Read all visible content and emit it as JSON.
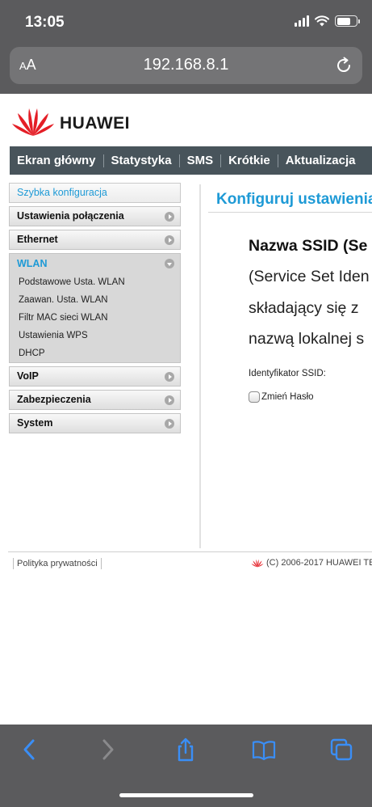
{
  "status_bar": {
    "time": "13:05"
  },
  "address_bar": {
    "aa_label_big": "A",
    "aa_label_small": "A",
    "url": "192.168.8.1"
  },
  "header": {
    "brand": "HUAWEI"
  },
  "nav": [
    "Ekran główny",
    "Statystyka",
    "SMS",
    "Krótkie",
    "Aktualizacja"
  ],
  "sidebar": {
    "quick": "Szybka konfiguracja",
    "menus_top": [
      "Ustawienia połączenia",
      "Ethernet"
    ],
    "wlan": {
      "label": "WLAN",
      "items": [
        "Podstawowe Usta. WLAN",
        "Zaawan. Usta. WLAN",
        "Filtr MAC sieci WLAN",
        "Ustawienia WPS",
        "DHCP"
      ]
    },
    "menus_bottom": [
      "VoIP",
      "Zabezpieczenia",
      "System"
    ]
  },
  "content": {
    "title": "Konfiguruj ustawienia",
    "ssid_heading": "Nazwa SSID (Se",
    "desc_lines": [
      "(Service Set Iden",
      "składający się z",
      "nazwą lokalnej s"
    ],
    "ssid_label": "Identyfikator SSID:",
    "change_password": "Zmień Hasło"
  },
  "footer": {
    "privacy": "Polityka prywatności",
    "copyright": "(C) 2006-2017 HUAWEI TE"
  },
  "colors": {
    "accent": "#1e9ad6",
    "nav_bg": "#48545b",
    "chrome_bg": "#5b5b5d",
    "ios_blue": "#3a8ef6"
  }
}
